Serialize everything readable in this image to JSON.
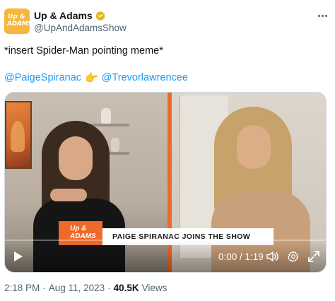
{
  "account": {
    "display_name": "Up & Adams",
    "handle": "@UpAndAdamsShow",
    "avatar_logo_top": "Up &",
    "avatar_logo_bottom": "ADAMS"
  },
  "tweet": {
    "text": "*insert Spider-Man pointing meme*",
    "mention_1": "@PaigeSpiranac",
    "emoji": "👉",
    "mention_2": "@Trevorlawrencee"
  },
  "video": {
    "banner_logo_top": "Up &",
    "banner_logo_bottom": "ADAMS",
    "lower_third": "PAIGE SPIRANAC JOINS THE SHOW",
    "time": "0:00 / 1:19",
    "progress_fraction": 0
  },
  "meta": {
    "time": "2:18 PM",
    "separator_1": "·",
    "date": "Aug 11, 2023",
    "separator_2": "·",
    "views": "40.5K",
    "views_label": "Views"
  },
  "colors": {
    "link": "#1d9bf0",
    "verified": "#e2b719",
    "brand_orange": "#ee6a2b"
  }
}
